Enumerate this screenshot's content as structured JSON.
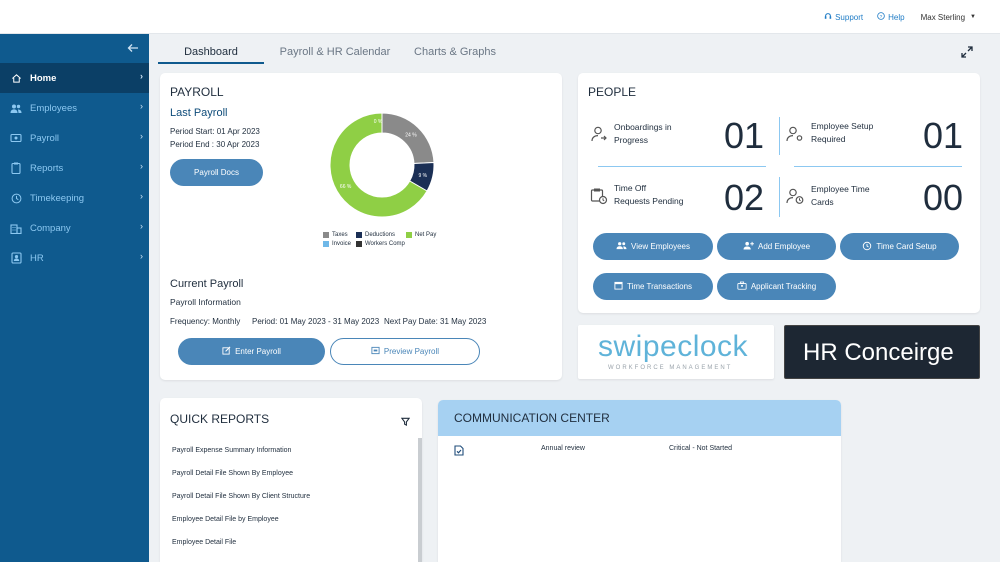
{
  "topbar": {
    "support": "Support",
    "help": "Help",
    "user": "Max Sterling"
  },
  "sidebar": {
    "items": [
      {
        "label": "Home",
        "icon": "home-icon"
      },
      {
        "label": "Employees",
        "icon": "users-icon"
      },
      {
        "label": "Payroll",
        "icon": "payroll-icon"
      },
      {
        "label": "Reports",
        "icon": "clipboard-icon"
      },
      {
        "label": "Timekeeping",
        "icon": "clock-icon"
      },
      {
        "label": "Company",
        "icon": "building-icon"
      },
      {
        "label": "HR",
        "icon": "id-card-icon"
      }
    ]
  },
  "tabs": [
    "Dashboard",
    "Payroll & HR Calendar",
    "Charts & Graphs"
  ],
  "payroll": {
    "title": "PAYROLL",
    "last_payroll": "Last Payroll",
    "period_start": "Period Start: 01 Apr 2023",
    "period_end": "Period End : 30 Apr 2023",
    "docs_button": "Payroll Docs",
    "current_payroll": "Current Payroll",
    "payroll_info": "Payroll Information",
    "frequency": "Frequency:  Monthly",
    "period": "Period:  01 May 2023 - 31 May 2023",
    "next_pay": "Next Pay Date:  31 May 2023",
    "enter_button": "Enter Payroll",
    "preview_button": "Preview Payroll"
  },
  "chart_data": {
    "type": "pie",
    "categories": [
      "Taxes",
      "Deductions",
      "Net Pay",
      "Invoice",
      "Workers Comp"
    ],
    "values": [
      24,
      9,
      66,
      0,
      0
    ],
    "data_labels": [
      "24 %",
      "9 %",
      "66 %",
      "0 %",
      "0 %"
    ],
    "colors": [
      "#8a8a8a",
      "#1b2f55",
      "#8fcf45",
      "#6fb8e8",
      "#333333"
    ],
    "title": "",
    "legend_position": "bottom"
  },
  "people": {
    "title": "PEOPLE",
    "stats": [
      {
        "label1": "Onboardings in",
        "label2": "Progress",
        "value": "01"
      },
      {
        "label1": "Employee Setup",
        "label2": "Required",
        "value": "01"
      },
      {
        "label1": "Time Off",
        "label2": "Requests Pending",
        "value": "02"
      },
      {
        "label1": "Employee Time",
        "label2": "Cards",
        "value": "00"
      }
    ],
    "buttons": [
      "View Employees",
      "Add Employee",
      "Time Card Setup",
      "Time Transactions",
      "Applicant Tracking"
    ]
  },
  "swipeclock": {
    "name": "swipeclock",
    "tagline": "WORKFORCE MANAGEMENT"
  },
  "hr_conceirge": "HR Conceirge",
  "quick_reports": {
    "title": "QUICK REPORTS",
    "items": [
      "Payroll Expense Summary Information",
      "Payroll Detail File Shown By Employee",
      "Payroll Detail File Shown By Client Structure",
      "Employee Detail File by Employee",
      "Employee Detail File"
    ]
  },
  "communication": {
    "title": "COMMUNICATION CENTER",
    "rows": [
      {
        "subject": "Annual review",
        "status": "Critical - Not Started"
      }
    ]
  }
}
